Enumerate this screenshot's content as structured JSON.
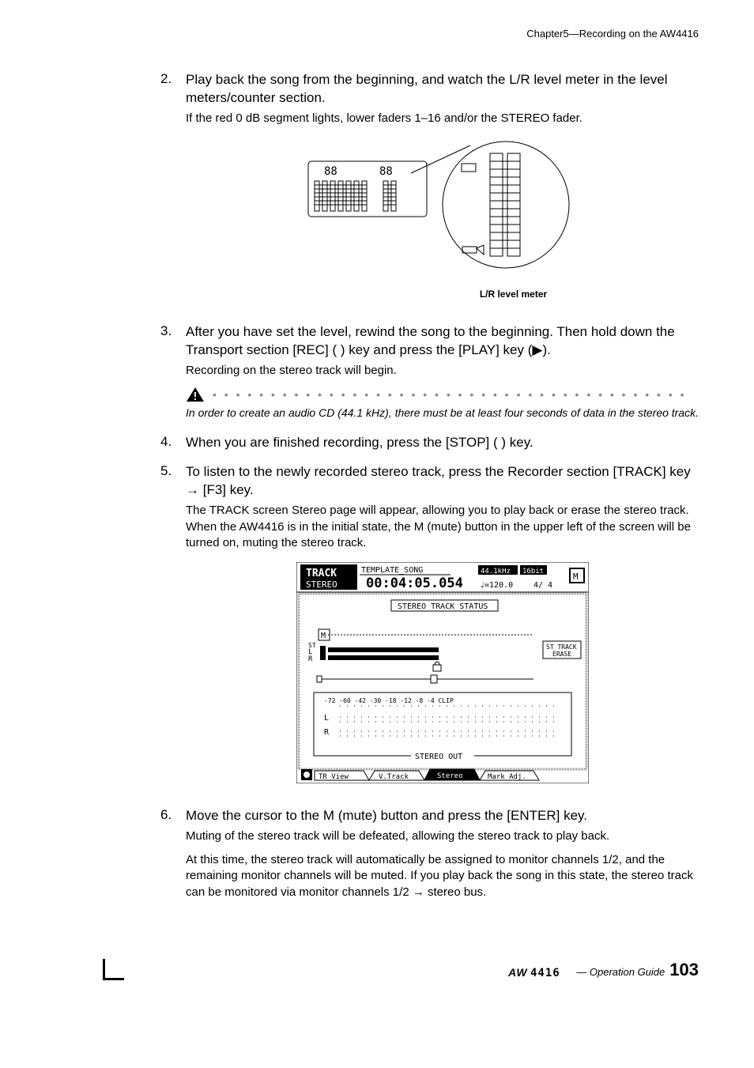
{
  "header": {
    "chapter": "Chapter5—Recording on the AW4416"
  },
  "steps": {
    "s2": {
      "num": "2.",
      "head": "Play back the song from the beginning, and watch the L/R level meter in the level meters/counter section.",
      "body": "If the red 0 dB segment lights, lower faders 1–16 and/or the STEREO fader."
    },
    "fig1_caption": "L/R level meter",
    "s3": {
      "num": "3.",
      "head": "After you have set the level, rewind the song to the beginning. Then hold down the Transport section [REC] ( ) key and press the [PLAY] key (▶).",
      "body": "Recording on the stereo track will begin."
    },
    "warn": "In order to create an audio CD (44.1 kHz), there must be at least four seconds of data in the stereo track.",
    "s4": {
      "num": "4.",
      "head": "When you are finished recording, press the [STOP] ( ) key."
    },
    "s5": {
      "num": "5.",
      "head": "To listen to the newly recorded stereo track, press the Recorder section [TRACK] key → [F3] key.",
      "body": "The TRACK screen Stereo page will appear, allowing you to play back or erase the stereo track. When the AW4416 is in the initial state, the M (mute) button in the upper left of the screen will be turned on, muting the stereo track."
    },
    "screen": {
      "title": "TRACK",
      "subtitle": "STEREO",
      "template": "TEMPLATE_SONG",
      "timecode": "00:04:05.054",
      "rate": "44.1kHz",
      "bits": "16bit",
      "tempo": "♩=120.0",
      "sig": "4/ 4",
      "status_label": "STEREO TRACK STATUS",
      "erase_btn": "ST TRACK ERASE",
      "m_btn": "M",
      "st_l": "L",
      "st_r": "R",
      "scale": [
        "-72",
        "-60",
        "-42",
        "-30",
        "-18",
        "-12",
        "-8",
        "-4",
        "CLIP"
      ],
      "out_label": "STEREO OUT",
      "tabs": [
        "TR View",
        "V.Track",
        "Stereo",
        "Mark Adj."
      ]
    },
    "s6": {
      "num": "6.",
      "head": "Move the cursor to the M (mute) button and press the [ENTER] key.",
      "body1": "Muting of the stereo track will be defeated, allowing the stereo track to play back.",
      "body2": "At this time, the stereo track will automatically be assigned to monitor channels 1/2, and the remaining monitor channels will be muted. If you play back the song in this state, the stereo track can be monitored via monitor channels 1/2 → stereo bus."
    }
  },
  "footer": {
    "logo": "AW4416",
    "guide": "— Operation Guide",
    "page": "103"
  }
}
